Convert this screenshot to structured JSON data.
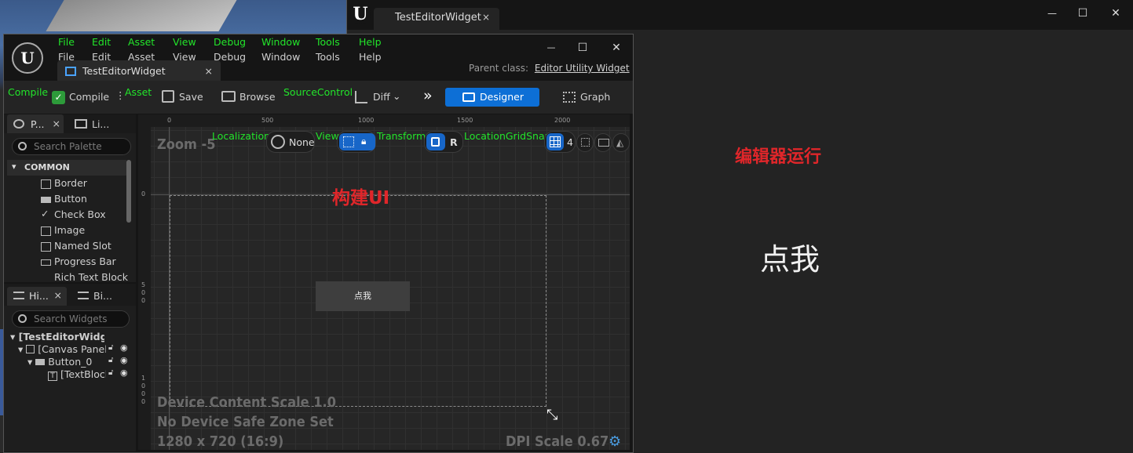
{
  "preview": {
    "tab_title": "TestEditorWidget",
    "tab_close": "×",
    "min": "—",
    "max": "☐",
    "close": "✕",
    "annotation": "编辑器运行",
    "button_text": "点我"
  },
  "editor": {
    "menu_green": [
      "File",
      "Edit",
      "Asset",
      "View",
      "Debug",
      "Window",
      "Tools",
      "Help"
    ],
    "menu_white": [
      "File",
      "Edit",
      "Asset",
      "View",
      "Debug",
      "Window",
      "Tools",
      "Help"
    ],
    "tab_title": "TestEditorWidget",
    "tab_close": "×",
    "min": "—",
    "max": "☐",
    "close": "✕",
    "parent_label": "Parent class:",
    "parent_value": "Editor Utility Widget",
    "toolbar": {
      "compile_green": "Compile",
      "compile": "Compile",
      "asset_green": "Asset",
      "save": "Save",
      "browse": "Browse",
      "sourcecontrol_green": "SourceControl",
      "diff": "Diff",
      "designer": "Designer",
      "graph": "Graph"
    },
    "palette": {
      "tab1": "P...",
      "tab2": "Li...",
      "search_placeholder": "Search Palette",
      "category": "COMMON",
      "items": [
        "Border",
        "Button",
        "Check Box",
        "Image",
        "Named Slot",
        "Progress Bar",
        "Rich Text Block"
      ]
    },
    "hierarchy": {
      "tab1": "Hi...",
      "tab2": "Bi...",
      "search_placeholder": "Search Widgets",
      "root": "[TestEditorWidget]",
      "items": [
        "[Canvas Panel]",
        "Button_0",
        "[TextBlock]"
      ]
    },
    "canvas": {
      "zoom": "Zoom -5",
      "ruler_h": [
        "0",
        "500",
        "1000",
        "1500",
        "2000"
      ],
      "ruler_v": [
        "0",
        "500",
        "1000"
      ],
      "toolbar_green": [
        "Localization",
        "View",
        "Transform",
        "LocationGridSnap"
      ],
      "none": "None",
      "r_label": "R",
      "grid_value": "4",
      "annotation": "构建UI",
      "button_text": "点我",
      "info_scale": "Device Content Scale 1.0",
      "info_safezone": "No Device Safe Zone Set",
      "info_resolution": "1280 x 720 (16:9)",
      "dpi": "DPI Scale 0.67"
    }
  }
}
